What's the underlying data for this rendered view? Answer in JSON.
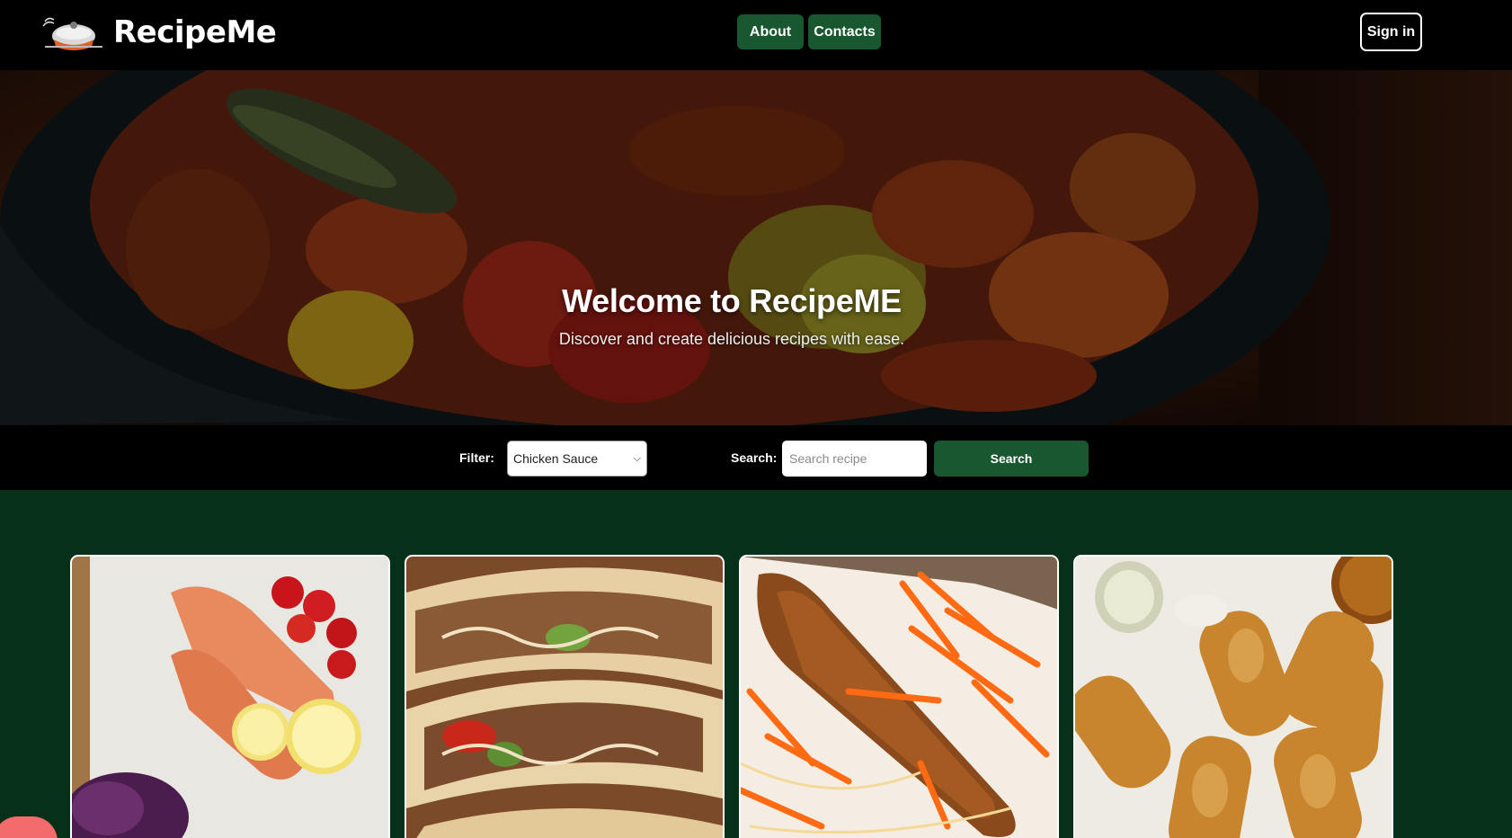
{
  "header": {
    "brand": "RecipeMe",
    "nav": {
      "about": "About",
      "contacts": "Contacts"
    },
    "sign_in": "Sign in"
  },
  "hero": {
    "title": "Welcome to RecipeME",
    "subtitle": "Discover and create delicious recipes with ease."
  },
  "toolbar": {
    "filter_label": "Filter:",
    "filter_value": "Chicken Sauce",
    "search_label": "Search:",
    "search_placeholder": "Search recipe",
    "search_button": "Search"
  },
  "recipes": [
    {
      "image": "salmon-with-lemon-and-tomatoes"
    },
    {
      "image": "fish-tacos"
    },
    {
      "image": "fried-fish-with-carrots"
    },
    {
      "image": "croquettes"
    }
  ],
  "colors": {
    "nav_bg": "#000000",
    "accent_green": "#195730",
    "page_bg": "#073019",
    "hero_dark": "#2a130b"
  }
}
